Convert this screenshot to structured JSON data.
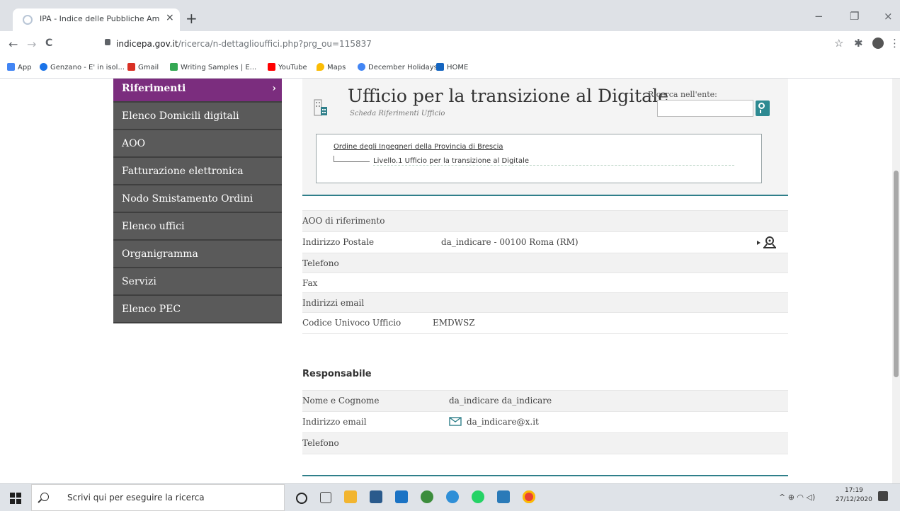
{
  "browser": {
    "tab_title": "IPA - Indice delle Pubbliche Amm",
    "tab_close": "×",
    "new_tab": "+",
    "window_controls": {
      "minimize": "−",
      "maximize": "❐",
      "close": "×"
    },
    "nav": {
      "back": "←",
      "forward": "→",
      "reload": "C"
    },
    "url_host": "indicepa.gov.it",
    "url_path": "/ricerca/n-dettagliouffici.php?prg_ou=115837",
    "toolbar_icons": {
      "star": "☆",
      "extensions": "✱",
      "menu": "⋮"
    },
    "bookmarks": [
      {
        "label": "App",
        "color": "#4285f4"
      },
      {
        "label": "Genzano - E' in isol...",
        "color": "#1a73e8"
      },
      {
        "label": "Gmail",
        "color": "#d93025"
      },
      {
        "label": "Writing Samples | E...",
        "color": "#34a853"
      },
      {
        "label": "YouTube",
        "color": "#ff0000"
      },
      {
        "label": "Maps",
        "color": "#fbbc04"
      },
      {
        "label": "December Holidays",
        "color": "#4285f4"
      },
      {
        "label": "HOME",
        "color": "#1565c0"
      }
    ]
  },
  "sidebar": {
    "items": [
      {
        "label": "Riferimenti",
        "chevron": "›"
      },
      {
        "label": "Elenco Domicili digitali"
      },
      {
        "label": "AOO"
      },
      {
        "label": "Fatturazione elettronica"
      },
      {
        "label": "Nodo Smistamento Ordini"
      },
      {
        "label": "Elenco uffici"
      },
      {
        "label": "Organigramma"
      },
      {
        "label": "Servizi"
      },
      {
        "label": "Elenco PEC"
      }
    ]
  },
  "header": {
    "title": "Ufficio per la transizione al Digitale",
    "subtitle": "Scheda Riferimenti Ufficio",
    "search_label": "Ricerca nell'ente:",
    "search_value": ""
  },
  "tree": {
    "parent": "Ordine degli Ingegneri della Provincia di Brescia",
    "child": "Livello.1 Ufficio per la transizione al Digitale"
  },
  "info_rows": [
    {
      "label": "AOO di riferimento",
      "value": ""
    },
    {
      "label": "Indirizzo Postale",
      "value": "da_indicare - 00100 Roma (RM)"
    },
    {
      "label": "Telefono",
      "value": ""
    },
    {
      "label": "Fax",
      "value": ""
    },
    {
      "label": "Indirizzi email",
      "value": ""
    },
    {
      "label": "Codice Univoco Ufficio",
      "value": "EMDWSZ"
    }
  ],
  "responsabile": {
    "title": "Responsabile",
    "rows": [
      {
        "label": "Nome e Cognome",
        "value": "da_indicare da_indicare"
      },
      {
        "label": "Indirizzo email",
        "value": "da_indicare@x.it"
      },
      {
        "label": "Telefono",
        "value": ""
      }
    ]
  },
  "taskbar": {
    "search_placeholder": "Scrivi qui per eseguire la ricerca",
    "time": "17:19",
    "date": "27/12/2020",
    "tray": "^ ⊕ ◠ ◁)"
  }
}
